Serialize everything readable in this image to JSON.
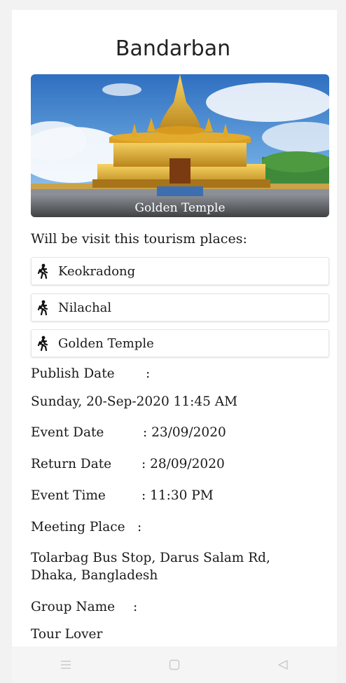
{
  "header": {
    "title": "Bandarban"
  },
  "hero": {
    "caption": "Golden Temple"
  },
  "places": {
    "heading": "Will be visit this tourism places:",
    "items": [
      {
        "label": "Keokradong",
        "icon": "hiker-icon"
      },
      {
        "label": "Nilachal",
        "icon": "hiker-icon"
      },
      {
        "label": "Golden Temple",
        "icon": "hiker-icon"
      }
    ]
  },
  "details": {
    "publish_label": "Publish Date",
    "publish_value": "Sunday, 20-Sep-2020 11:45 AM",
    "event_date_label": "Event Date",
    "event_date_value": ": 23/09/2020",
    "return_date_label": "Return Date",
    "return_date_value": ": 28/09/2020",
    "event_time_label": "Event Time",
    "event_time_value": ": 11:30 PM",
    "meeting_label": "Meeting Place",
    "meeting_value_line1": "Tolarbag Bus Stop, Darus Salam Rd,",
    "meeting_value_line2": "Dhaka, Bangladesh",
    "group_label": "Group Name",
    "group_value": "Tour Lover",
    "colon": ":"
  },
  "navbar": {
    "icons": [
      "menu-icon",
      "home-icon",
      "back-icon"
    ]
  }
}
